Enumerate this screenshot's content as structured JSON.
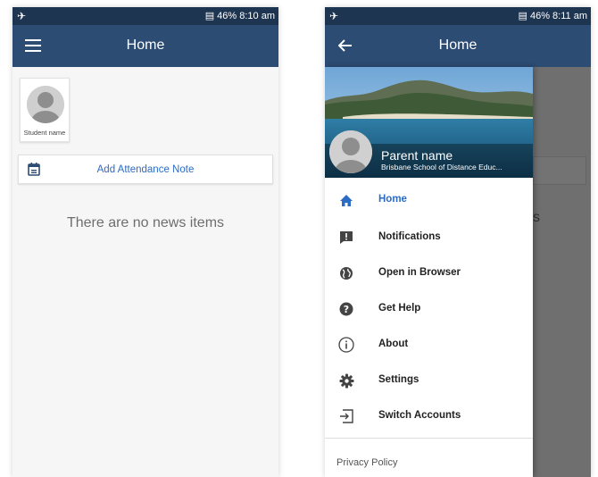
{
  "left_screen": {
    "status": {
      "right_text": "46% 8:10 am"
    },
    "appbar": {
      "title": "Home",
      "nav_icon": "menu-icon"
    },
    "student": {
      "name": "Student name"
    },
    "attendance": {
      "label": "Add Attendance Note",
      "icon": "calendar-note-icon"
    },
    "empty_message": "There are no news items"
  },
  "right_screen": {
    "status": {
      "right_text": "46% 8:11 am"
    },
    "appbar": {
      "title": "Home",
      "nav_icon": "back-arrow-icon"
    },
    "behind_text": "s",
    "drawer": {
      "parent_name": "Parent name",
      "school": "Brisbane School of Distance Educ...",
      "items": [
        {
          "label": "Home",
          "icon": "home-icon",
          "active": true
        },
        {
          "label": "Notifications",
          "icon": "notification-icon",
          "active": false
        },
        {
          "label": "Open in Browser",
          "icon": "globe-icon",
          "active": false
        },
        {
          "label": "Get Help",
          "icon": "help-icon",
          "active": false
        },
        {
          "label": "About",
          "icon": "info-icon",
          "active": false
        },
        {
          "label": "Settings",
          "icon": "gear-icon",
          "active": false
        },
        {
          "label": "Switch Accounts",
          "icon": "switch-account-icon",
          "active": false
        }
      ],
      "privacy_label": "Privacy Policy"
    }
  },
  "colors": {
    "status_bar": "#1e3551",
    "app_bar": "#2d4c73",
    "accent": "#2c6cc4"
  }
}
